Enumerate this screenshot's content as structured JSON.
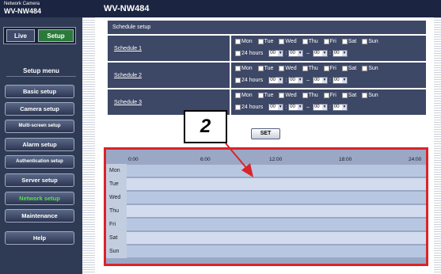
{
  "header": {
    "brand_small": "Network Camera",
    "brand_model": "WV-NW484",
    "title": "WV-NW484"
  },
  "mode": {
    "live": "Live",
    "setup": "Setup"
  },
  "menu": {
    "title": "Setup menu",
    "items": [
      {
        "label": "Basic setup"
      },
      {
        "label": "Camera setup"
      },
      {
        "label": "Multi-screen setup"
      },
      {
        "label": "Alarm setup"
      },
      {
        "label": "Authentication setup"
      },
      {
        "label": "Server setup"
      },
      {
        "label": "Network setup"
      },
      {
        "label": "Maintenance"
      },
      {
        "label": "Help"
      }
    ],
    "active": "Network setup"
  },
  "schedule": {
    "header": "Schedule setup",
    "days": [
      "Mon",
      "Tue",
      "Wed",
      "Thu",
      "Fri",
      "Sat",
      "Sun"
    ],
    "hours24_label": "24 hours",
    "time_values": [
      "00",
      "00",
      "00",
      "00"
    ],
    "range_separator": "–",
    "colon": ":",
    "rows": [
      {
        "label": "Schedule 1"
      },
      {
        "label": "Schedule 2"
      },
      {
        "label": "Schedule 3"
      }
    ],
    "set_label": "SET"
  },
  "timeline": {
    "hour_labels": [
      "0:00",
      "6:00",
      "12:00",
      "18:00",
      "24:00"
    ],
    "days": [
      "Mon",
      "Tue",
      "Wed",
      "Thu",
      "Fri",
      "Sat",
      "Sun"
    ]
  },
  "callout": {
    "number": "2"
  },
  "colors": {
    "accent_red": "#d9242a",
    "active_menu": "#56e24d",
    "setup_green": "#2b7a3a"
  }
}
